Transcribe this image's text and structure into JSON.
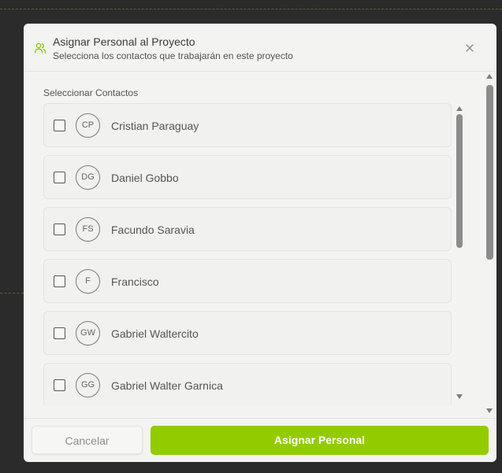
{
  "dialog": {
    "title": "Asignar Personal al Proyecto",
    "subtitle": "Selecciona los contactos que trabajarán en este proyecto",
    "header_icon": "users-icon",
    "close_icon": "close-icon"
  },
  "contacts_section": {
    "label": "Seleccionar Contactos",
    "items": [
      {
        "initials": "CP",
        "name": "Cristian Paraguay",
        "checked": false
      },
      {
        "initials": "DG",
        "name": "Daniel Gobbo",
        "checked": false
      },
      {
        "initials": "FS",
        "name": "Facundo Saravia",
        "checked": false
      },
      {
        "initials": "F",
        "name": "Francisco",
        "checked": false
      },
      {
        "initials": "GW",
        "name": "Gabriel Waltercito",
        "checked": false
      },
      {
        "initials": "GG",
        "name": "Gabriel Walter Garnica",
        "checked": false
      }
    ]
  },
  "footer": {
    "cancel_label": "Cancelar",
    "assign_label": "Asignar Personal"
  },
  "colors": {
    "accent": "#92cc00",
    "icon_accent": "#8ac400",
    "background": "#2b2b2b",
    "modal": "#f3f3f2"
  }
}
